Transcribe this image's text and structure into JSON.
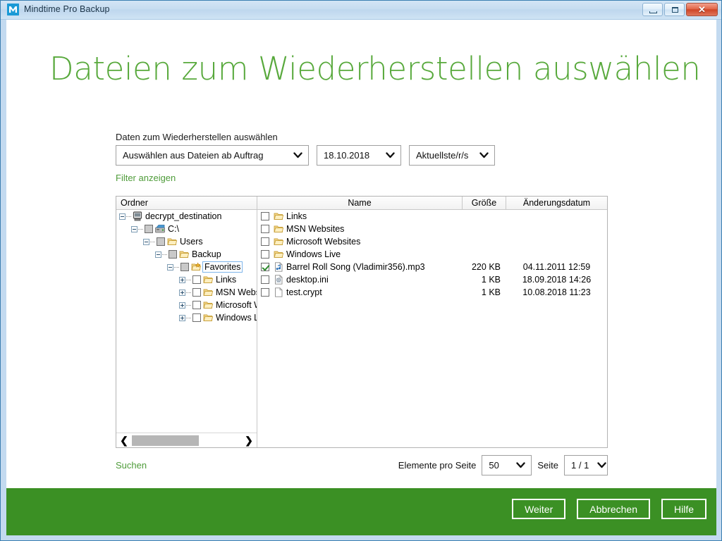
{
  "window": {
    "title": "Mindtime Pro Backup",
    "logo_icon": "mindtime-m-logo",
    "minimize_label": "",
    "maximize_label": "",
    "close_label": "✕",
    "accent_green": "#3b9024",
    "title_green": "#58a93c"
  },
  "page": {
    "heading": "Dateien zum Wiederherstellen auswählen",
    "form_label": "Daten zum Wiederherstellen auswählen",
    "filter_link": "Filter anzeigen",
    "search_link": "Suchen"
  },
  "selects": {
    "source": "Auswählen aus Dateien ab Auftrag",
    "date": "18.10.2018",
    "version": "Aktuellste/r/s",
    "items_per_page_label": "Elemente pro Seite",
    "items_per_page": "50",
    "page_label": "Seite",
    "page_value": "1 / 1"
  },
  "table": {
    "headers": {
      "folder": "Ordner",
      "name": "Name",
      "size": "Größe",
      "modified": "Änderungsdatum"
    }
  },
  "tree": [
    {
      "label": "decrypt_destination",
      "depth": 0,
      "expander": "minus",
      "checkbox": "none",
      "icon": "computer-icon"
    },
    {
      "label": "C:\\",
      "depth": 1,
      "expander": "minus",
      "checkbox": "filled",
      "icon": "drive-icon"
    },
    {
      "label": "Users",
      "depth": 2,
      "expander": "minus",
      "checkbox": "filled",
      "icon": "folder-icon"
    },
    {
      "label": "Backup",
      "depth": 3,
      "expander": "minus",
      "checkbox": "filled",
      "icon": "folder-icon"
    },
    {
      "label": "Favorites",
      "depth": 4,
      "expander": "minus",
      "checkbox": "filled",
      "icon": "favorites-folder-icon",
      "selected": true
    },
    {
      "label": "Links",
      "depth": 5,
      "expander": "plus",
      "checkbox": "empty",
      "icon": "folder-icon"
    },
    {
      "label": "MSN Websites",
      "depth": 5,
      "expander": "plus",
      "checkbox": "empty",
      "icon": "folder-icon"
    },
    {
      "label": "Microsoft Websites",
      "depth": 5,
      "expander": "plus",
      "checkbox": "empty",
      "icon": "folder-icon"
    },
    {
      "label": "Windows Live",
      "depth": 5,
      "expander": "plus",
      "checkbox": "empty",
      "icon": "folder-icon"
    }
  ],
  "files": [
    {
      "name": "Links",
      "size": "",
      "modified": "",
      "icon": "folder-icon",
      "checked": false
    },
    {
      "name": "MSN Websites",
      "size": "",
      "modified": "",
      "icon": "folder-icon",
      "checked": false
    },
    {
      "name": "Microsoft Websites",
      "size": "",
      "modified": "",
      "icon": "folder-icon",
      "checked": false
    },
    {
      "name": "Windows Live",
      "size": "",
      "modified": "",
      "icon": "folder-icon",
      "checked": false
    },
    {
      "name": "Barrel Roll Song (Vladimir356).mp3",
      "size": "220 KB",
      "modified": "04.11.2011 12:59",
      "icon": "audio-file-icon",
      "checked": true
    },
    {
      "name": "desktop.ini",
      "size": "1 KB",
      "modified": "18.09.2018 14:26",
      "icon": "config-file-icon",
      "checked": false
    },
    {
      "name": "test.crypt",
      "size": "1 KB",
      "modified": "10.08.2018 11:23",
      "icon": "generic-file-icon",
      "checked": false
    }
  ],
  "scrollbar": {
    "left_arrow": "❮",
    "right_arrow": "❯"
  },
  "footer": {
    "next": "Weiter",
    "cancel": "Abbrechen",
    "help": "Hilfe"
  }
}
